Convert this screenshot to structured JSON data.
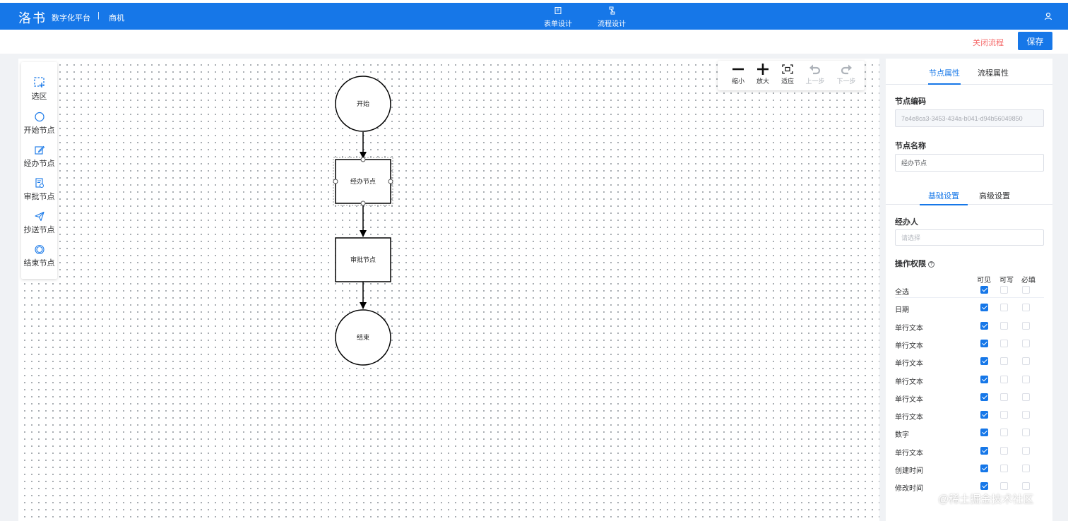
{
  "header": {
    "logo": "洛书",
    "platform": "数字化平台",
    "separator": "|",
    "breadcrumb": "商机",
    "tabs": [
      {
        "label": "表单设计",
        "icon": "form-icon",
        "active": false
      },
      {
        "label": "流程设计",
        "icon": "flow-icon",
        "active": true
      }
    ],
    "user_icon": "user-icon"
  },
  "actions": {
    "close_label": "关闭流程",
    "save_label": "保存"
  },
  "palette": {
    "items": [
      {
        "label": "选区",
        "icon": "selection-icon"
      },
      {
        "label": "开始节点",
        "icon": "circle-icon"
      },
      {
        "label": "经办节点",
        "icon": "edit-icon"
      },
      {
        "label": "审批节点",
        "icon": "approve-icon"
      },
      {
        "label": "抄送节点",
        "icon": "send-icon"
      },
      {
        "label": "结束节点",
        "icon": "double-circle-icon"
      }
    ]
  },
  "zoom_toolbar": {
    "items": [
      {
        "label": "缩小",
        "icon": "minus-icon",
        "enabled": true
      },
      {
        "label": "放大",
        "icon": "plus-icon",
        "enabled": true
      },
      {
        "label": "适应",
        "icon": "fit-icon",
        "enabled": true
      },
      {
        "label": "上一步",
        "icon": "undo-icon",
        "enabled": false
      },
      {
        "label": "下一步",
        "icon": "redo-icon",
        "enabled": false
      }
    ]
  },
  "flow": {
    "nodes": [
      {
        "label": "开始",
        "shape": "circle"
      },
      {
        "label": "经办节点",
        "shape": "rect",
        "selected": true
      },
      {
        "label": "审批节点",
        "shape": "rect"
      },
      {
        "label": "结束",
        "shape": "circle"
      }
    ]
  },
  "panel": {
    "tabs": [
      {
        "label": "节点属性",
        "active": true
      },
      {
        "label": "流程属性",
        "active": false
      }
    ],
    "node_code_label": "节点编码",
    "node_code_value": "7e4e8ca3-3453-434a-b041-d94b56049850",
    "node_name_label": "节点名称",
    "node_name_value": "经办节点",
    "settings_tabs": [
      {
        "label": "基础设置",
        "active": true
      },
      {
        "label": "高级设置",
        "active": false
      }
    ],
    "handler_label": "经办人",
    "handler_placeholder": "请选择",
    "permissions": {
      "title": "操作权限",
      "help_icon": "question-circle-icon",
      "columns": [
        "可见",
        "可写",
        "必填"
      ],
      "rows": [
        {
          "name": "全选",
          "visible": true,
          "writable": false,
          "required": false
        },
        {
          "name": "日期",
          "visible": true,
          "writable": false,
          "required": false
        },
        {
          "name": "单行文本",
          "visible": true,
          "writable": false,
          "required": false
        },
        {
          "name": "单行文本",
          "visible": true,
          "writable": false,
          "required": false
        },
        {
          "name": "单行文本",
          "visible": true,
          "writable": false,
          "required": false
        },
        {
          "name": "单行文本",
          "visible": true,
          "writable": false,
          "required": false
        },
        {
          "name": "单行文本",
          "visible": true,
          "writable": false,
          "required": false
        },
        {
          "name": "单行文本",
          "visible": true,
          "writable": false,
          "required": false
        },
        {
          "name": "数字",
          "visible": true,
          "writable": false,
          "required": false
        },
        {
          "name": "单行文本",
          "visible": true,
          "writable": false,
          "required": false
        },
        {
          "name": "创建时间",
          "visible": true,
          "writable": false,
          "required": false
        },
        {
          "name": "修改时间",
          "visible": true,
          "writable": false,
          "required": false
        }
      ]
    }
  },
  "watermark": "@稀土掘金技术社区"
}
